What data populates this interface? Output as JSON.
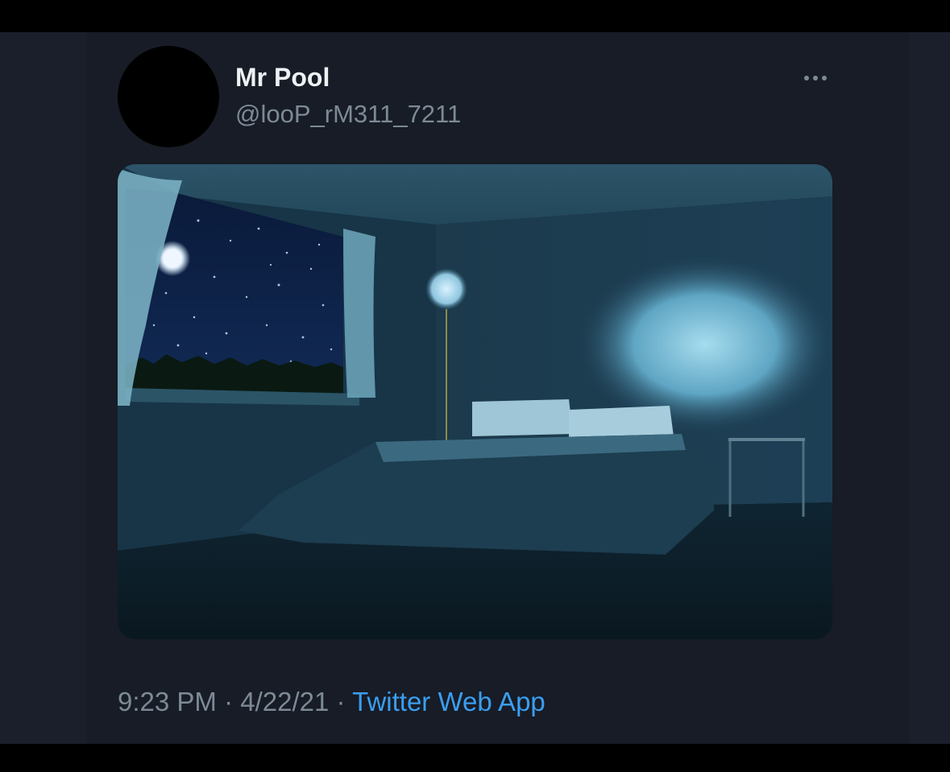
{
  "tweet": {
    "display_name": "Mr Pool",
    "handle": "@looP_rM311_7211",
    "time": "9:23 PM",
    "separator": "·",
    "date": "4/22/21",
    "source": "Twitter Web App"
  },
  "icons": {
    "more": "more-horizontal-icon"
  },
  "colors": {
    "background": "#171c26",
    "text_primary": "#eef1f4",
    "text_secondary": "#7d8a96",
    "link": "#3b9ef0"
  }
}
